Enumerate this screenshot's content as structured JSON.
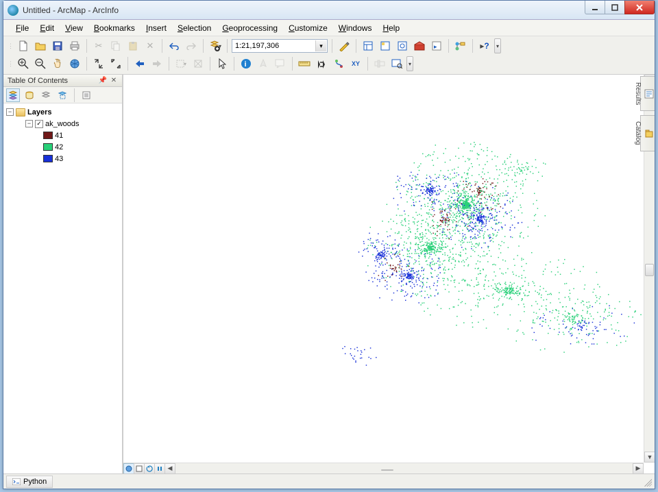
{
  "title": "Untitled - ArcMap - ArcInfo",
  "menu": [
    "File",
    "Edit",
    "View",
    "Bookmarks",
    "Insert",
    "Selection",
    "Geoprocessing",
    "Customize",
    "Windows",
    "Help"
  ],
  "scale": "1:21,197,306",
  "toc": {
    "title": "Table Of Contents",
    "root": "Layers",
    "layer": "ak_woods",
    "legend": [
      {
        "label": "41",
        "color": "#701818"
      },
      {
        "label": "42",
        "color": "#28d078"
      },
      {
        "label": "43",
        "color": "#1830d8"
      }
    ]
  },
  "sidetabs": [
    "Results",
    "Catalog"
  ],
  "status": {
    "python": "Python"
  },
  "colors": {
    "c41": "#701818",
    "c42": "#28d078",
    "c43": "#1830d8"
  }
}
